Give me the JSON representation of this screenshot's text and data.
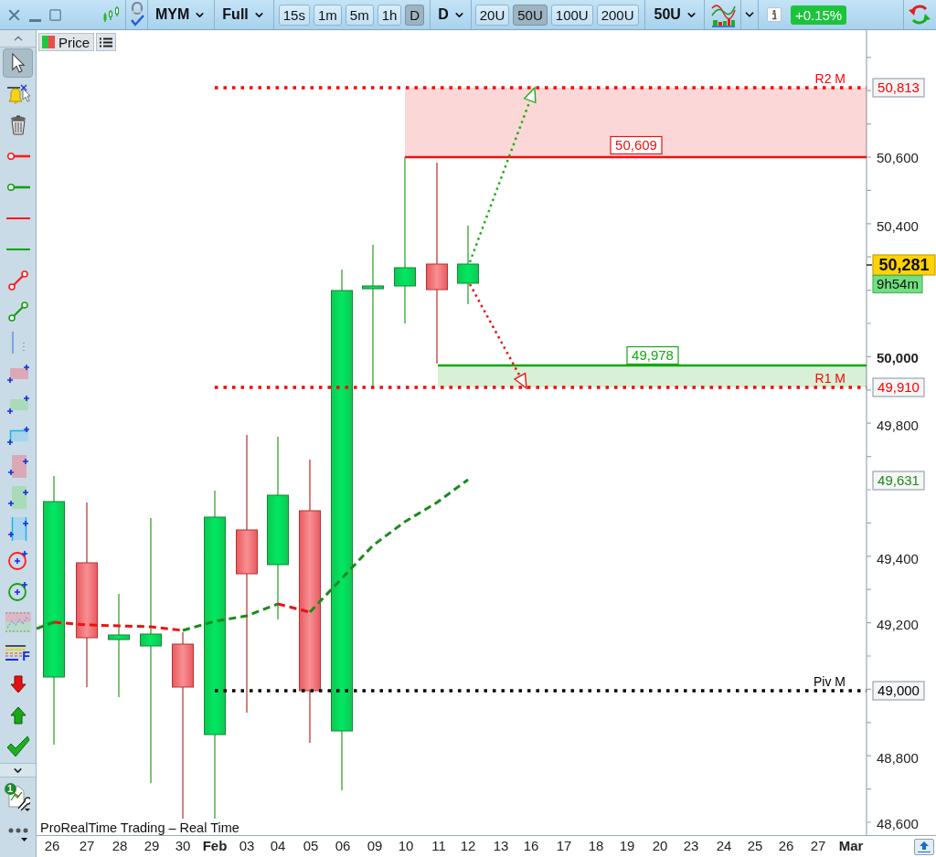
{
  "toolbar": {
    "symbol": "MYM",
    "layout": "Full",
    "intervals": [
      {
        "label": "15s",
        "selected": false
      },
      {
        "label": "1m",
        "selected": false
      },
      {
        "label": "5m",
        "selected": false
      },
      {
        "label": "1h",
        "selected": false
      },
      {
        "label": "D",
        "selected": true
      }
    ],
    "period": "D",
    "units": [
      {
        "label": "20U",
        "selected": false
      },
      {
        "label": "50U",
        "selected": true
      },
      {
        "label": "100U",
        "selected": false
      },
      {
        "label": "200U",
        "selected": false
      }
    ],
    "units_menu": "50U",
    "change": "+0.15%"
  },
  "left_toolbar": {
    "tools": [
      {
        "kind": "pointer",
        "selected": true
      },
      {
        "kind": "alert",
        "selected": false
      },
      {
        "kind": "trash",
        "selected": false
      },
      {
        "kind": "order-line",
        "color": "#ff1a1a",
        "selected": false
      },
      {
        "kind": "order-line",
        "color": "#12a012",
        "selected": false
      },
      {
        "kind": "hline",
        "color": "#ff1a1a",
        "selected": false
      },
      {
        "kind": "hline",
        "color": "#12a012",
        "selected": false
      },
      {
        "kind": "segment",
        "color": "#ff1a1a",
        "selected": false
      },
      {
        "kind": "segment",
        "color": "#12a012",
        "selected": false
      },
      {
        "kind": "vline",
        "selected": false
      },
      {
        "kind": "rect",
        "color": "#dba9b5",
        "selected": false
      },
      {
        "kind": "rect",
        "color": "#a9dbb8",
        "selected": false
      },
      {
        "kind": "rect-frame",
        "selected": false
      },
      {
        "kind": "rect-tall",
        "color": "#dba9b5",
        "selected": false
      },
      {
        "kind": "rect-tall",
        "color": "#a9dbb8",
        "selected": false
      },
      {
        "kind": "rect-tall-frame",
        "selected": false
      },
      {
        "kind": "circle",
        "color": "#ff1a1a",
        "selected": false
      },
      {
        "kind": "circle",
        "color": "#12a012",
        "selected": false
      },
      {
        "kind": "channel",
        "selected": false
      },
      {
        "kind": "fibonacci",
        "label": "F",
        "selected": false
      },
      {
        "kind": "sell-arrow",
        "selected": false
      },
      {
        "kind": "buy-arrow",
        "selected": false
      },
      {
        "kind": "check",
        "selected": false
      }
    ],
    "settings_badge": "1"
  },
  "chart": {
    "tab": "Price",
    "levels": [
      {
        "label": "R2 M",
        "value": "50,813",
        "color": "#ff0000"
      },
      {
        "label": "R1 M",
        "value": "49,910",
        "color": "#ff0000"
      },
      {
        "label": "Piv M",
        "value": "49,000",
        "color": "#000000"
      }
    ],
    "zones": [
      {
        "value": "50,609",
        "color": "#ee1111"
      },
      {
        "value": "49,978",
        "color": "#14a814"
      }
    ],
    "average_value": "49,631",
    "last_price": "50,281",
    "countdown": "9h54m",
    "price_axis": [
      {
        "label": "50,600",
        "major": false
      },
      {
        "label": "50,400",
        "major": false
      },
      {
        "label": "50,000",
        "major": true
      },
      {
        "label": "49,800",
        "major": false
      },
      {
        "label": "49,400",
        "major": false
      },
      {
        "label": "49,200",
        "major": false
      },
      {
        "label": "48,800",
        "major": false
      },
      {
        "label": "48,600",
        "major": false
      }
    ],
    "time_axis": [
      {
        "label": "26",
        "month": false
      },
      {
        "label": "27",
        "month": false
      },
      {
        "label": "28",
        "month": false
      },
      {
        "label": "29",
        "month": false
      },
      {
        "label": "30",
        "month": false
      },
      {
        "label": "Feb",
        "month": true
      },
      {
        "label": "03",
        "month": false
      },
      {
        "label": "04",
        "month": false
      },
      {
        "label": "05",
        "month": false
      },
      {
        "label": "06",
        "month": false
      },
      {
        "label": "09",
        "month": false
      },
      {
        "label": "10",
        "month": false
      },
      {
        "label": "11",
        "month": false
      },
      {
        "label": "12",
        "month": false
      },
      {
        "label": "13",
        "month": false
      },
      {
        "label": "16",
        "month": false
      },
      {
        "label": "17",
        "month": false
      },
      {
        "label": "18",
        "month": false
      },
      {
        "label": "19",
        "month": false
      },
      {
        "label": "20",
        "month": false
      },
      {
        "label": "23",
        "month": false
      },
      {
        "label": "24",
        "month": false
      },
      {
        "label": "25",
        "month": false
      },
      {
        "label": "26",
        "month": false
      },
      {
        "label": "27",
        "month": false
      },
      {
        "label": "Mar",
        "month": true
      }
    ],
    "source": "ProRealTime Trading – Real Time"
  }
}
